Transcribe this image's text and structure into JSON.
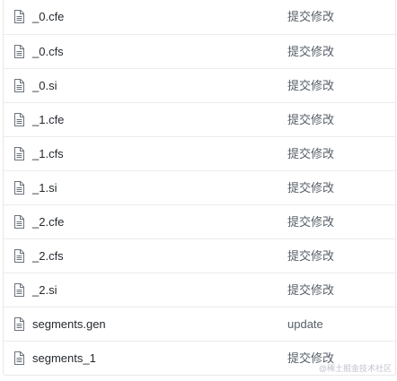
{
  "files": [
    {
      "name": "_0.cfe",
      "message": "提交修改",
      "icon": "file-icon"
    },
    {
      "name": "_0.cfs",
      "message": "提交修改",
      "icon": "file-icon"
    },
    {
      "name": "_0.si",
      "message": "提交修改",
      "icon": "file-icon"
    },
    {
      "name": "_1.cfe",
      "message": "提交修改",
      "icon": "file-icon"
    },
    {
      "name": "_1.cfs",
      "message": "提交修改",
      "icon": "file-icon"
    },
    {
      "name": "_1.si",
      "message": "提交修改",
      "icon": "file-icon"
    },
    {
      "name": "_2.cfe",
      "message": "提交修改",
      "icon": "file-icon"
    },
    {
      "name": "_2.cfs",
      "message": "提交修改",
      "icon": "file-icon"
    },
    {
      "name": "_2.si",
      "message": "提交修改",
      "icon": "file-icon"
    },
    {
      "name": "segments.gen",
      "message": "update",
      "icon": "file-icon"
    },
    {
      "name": "segments_1",
      "message": "提交修改",
      "icon": "file-icon"
    }
  ],
  "watermark": "@稀土掘金技术社区",
  "colors": {
    "text": "#24292e",
    "message": "#586069",
    "border": "#ececec",
    "icon": "#6a737d"
  }
}
